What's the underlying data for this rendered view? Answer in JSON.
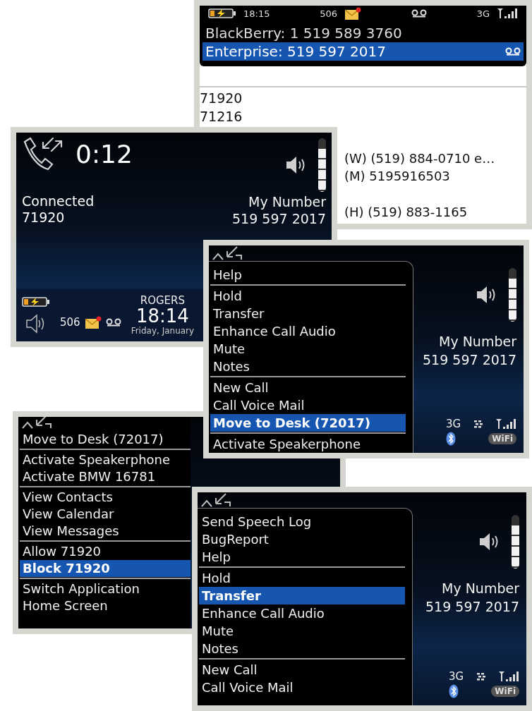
{
  "screens": [
    {
      "kind": "contact_popup",
      "status_bar": {
        "time": "18:15",
        "message_count": "506",
        "network": "3G"
      },
      "popup_items": [
        {
          "label": "BlackBerry: 1 519 589 3760",
          "selected": false
        },
        {
          "label": "Enterprise: 519 597 2017",
          "selected": true
        }
      ],
      "numbers": [
        "71920",
        "71216"
      ],
      "contact_numbers": [
        "(W) (519) 884-0710 e…",
        "(M) 5195916503",
        "(H) (519) 883-1165"
      ]
    },
    {
      "kind": "call",
      "timer": "0:12",
      "status": "Connected",
      "caller": "71920",
      "volume": {
        "level": 0.8
      },
      "my_number_label": "My Number",
      "my_number": "519 597 2017",
      "message_count": "506",
      "carrier": "ROGERS",
      "time": "18:14",
      "date": "Friday, January"
    },
    {
      "kind": "popup_menu",
      "menu_sections": [
        {
          "items": [
            {
              "label": "Help",
              "selected": false
            }
          ]
        },
        {
          "items": [
            {
              "label": "Hold",
              "selected": false
            },
            {
              "label": "Transfer",
              "selected": false
            },
            {
              "label": "Enhance Call Audio",
              "selected": false
            },
            {
              "label": "Mute",
              "selected": false
            },
            {
              "label": "Notes",
              "selected": false
            }
          ]
        },
        {
          "items": [
            {
              "label": "New Call",
              "selected": false
            },
            {
              "label": "Call Voice Mail",
              "selected": false
            },
            {
              "label": "Move to Desk (72017)",
              "selected": true
            }
          ]
        },
        {
          "items": [
            {
              "label": "Activate Speakerphone",
              "selected": false
            }
          ]
        }
      ],
      "volume": {
        "level": 0.8
      },
      "my_number_label": "My Number",
      "my_number": "519 597 2017",
      "network": "3G",
      "wifi_label": "WiFi"
    },
    {
      "kind": "full_menu",
      "menu_sections": [
        {
          "items": [
            {
              "label": "Move to Desk (72017)",
              "selected": false
            }
          ]
        },
        {
          "items": [
            {
              "label": "Activate Speakerphone",
              "selected": false
            },
            {
              "label": "Activate BMW 16781",
              "selected": false
            }
          ]
        },
        {
          "items": [
            {
              "label": "View Contacts",
              "selected": false
            },
            {
              "label": "View Calendar",
              "selected": false
            },
            {
              "label": "View Messages",
              "selected": false
            }
          ]
        },
        {
          "items": [
            {
              "label": "Allow 71920",
              "selected": false
            },
            {
              "label": "Block 71920",
              "selected": true
            }
          ]
        },
        {
          "items": [
            {
              "label": "Switch Application",
              "selected": false
            },
            {
              "label": "Home Screen",
              "selected": false
            }
          ]
        }
      ]
    },
    {
      "kind": "popup_menu",
      "menu_sections": [
        {
          "items": [
            {
              "label": "Send Speech Log",
              "selected": false
            },
            {
              "label": "BugReport",
              "selected": false
            },
            {
              "label": "Help",
              "selected": false
            }
          ]
        },
        {
          "items": [
            {
              "label": "Hold",
              "selected": false
            },
            {
              "label": "Transfer",
              "selected": true
            },
            {
              "label": "Enhance Call Audio",
              "selected": false
            },
            {
              "label": "Mute",
              "selected": false
            },
            {
              "label": "Notes",
              "selected": false
            }
          ]
        },
        {
          "items": [
            {
              "label": "New Call",
              "selected": false
            },
            {
              "label": "Call Voice Mail",
              "selected": false
            }
          ]
        }
      ],
      "volume": {
        "level": 0.8
      },
      "my_number_label": "My Number",
      "my_number": "519 597 2017",
      "network": "3G",
      "wifi_label": "WiFi"
    }
  ]
}
